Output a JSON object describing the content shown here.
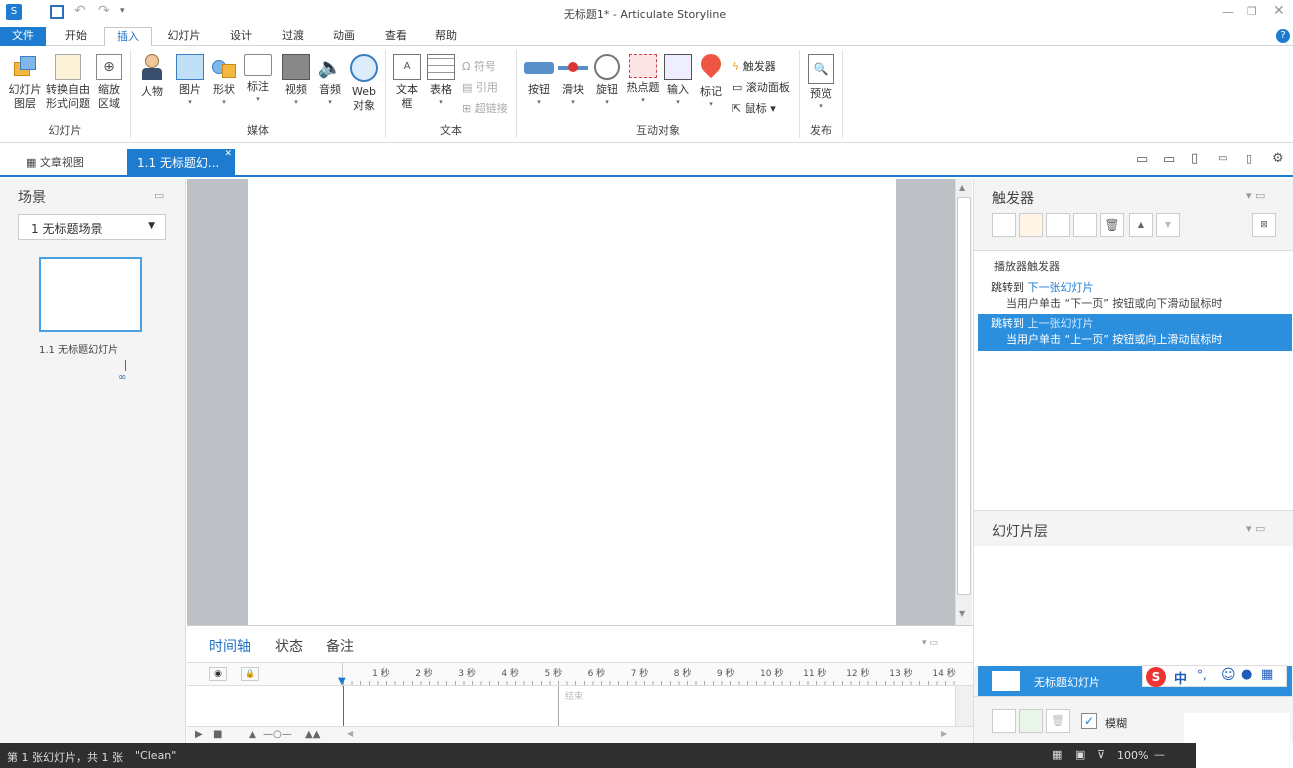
{
  "app": {
    "window_title": "无标题1* -  Articulate Storyline"
  },
  "ribbon_tabs": [
    "文件",
    "开始",
    "插入",
    "幻灯片",
    "设计",
    "过渡",
    "动画",
    "查看",
    "帮助"
  ],
  "ribbon": {
    "groups": {
      "slides": "幻灯片",
      "media": "媒体",
      "text": "文本",
      "interactive": "互动对象",
      "publish": "发布"
    },
    "buttons": {
      "slide_layer": "幻灯片图层",
      "convert_freeform": "转换自由形式问题",
      "zoom_region": "缩放区域",
      "character": "人物",
      "picture": "图片",
      "shape": "形状",
      "caption": "标注",
      "video": "视频",
      "audio": "音频",
      "web_object": "Web对象",
      "textbox": "文本框",
      "table": "表格",
      "symbol": "符号",
      "reference": "引用",
      "hyperlink": "超链接",
      "button": "按钮",
      "slider": "滑块",
      "dial": "旋钮",
      "hotspot": "热点题",
      "input": "输入",
      "marker": "标记",
      "trigger": "触发器",
      "scrolling_panel": "滚动面板",
      "mouse": "鼠标",
      "preview": "预览"
    }
  },
  "doc_tabs": {
    "story_view": "文章视图",
    "slide_tab": "1.1 无标题幻..."
  },
  "scenes": {
    "title": "场景",
    "selected_scene": "1 无标题场景",
    "slide_thumb_label": "1.1 无标题幻灯片"
  },
  "timeline": {
    "tabs": [
      "时间轴",
      "状态",
      "备注"
    ],
    "ruler": [
      "1 秒",
      "2 秒",
      "3 秒",
      "4 秒",
      "5 秒",
      "6 秒",
      "7 秒",
      "8 秒",
      "9 秒",
      "10 秒",
      "11 秒",
      "12 秒",
      "13 秒",
      "14 秒"
    ],
    "end_label": "结束"
  },
  "triggers": {
    "title": "触发器",
    "player_triggers": "播放器触发器",
    "items": [
      {
        "action": "跳转到",
        "target": "下一张幻灯片",
        "condition": "当用户单击 “下一页” 按钮或向下滑动鼠标时"
      },
      {
        "action": "跳转到",
        "target": "上一张幻灯片",
        "condition": "当用户单击 “上一页” 按钮或向上滑动鼠标时"
      }
    ]
  },
  "layers": {
    "title": "幻灯片层",
    "base_layer": "无标题幻灯片",
    "blur_label": "模糊"
  },
  "ime": {
    "lang": "中",
    "punct": "°,"
  },
  "status": {
    "slide_info": "第 1 张幻灯片，共 1 张",
    "theme": "\"Clean\"",
    "zoom": "100%"
  },
  "colors": {
    "accent": "#1e7cd0",
    "selected": "#2b8fde",
    "statusbar": "#2f2f2f"
  }
}
